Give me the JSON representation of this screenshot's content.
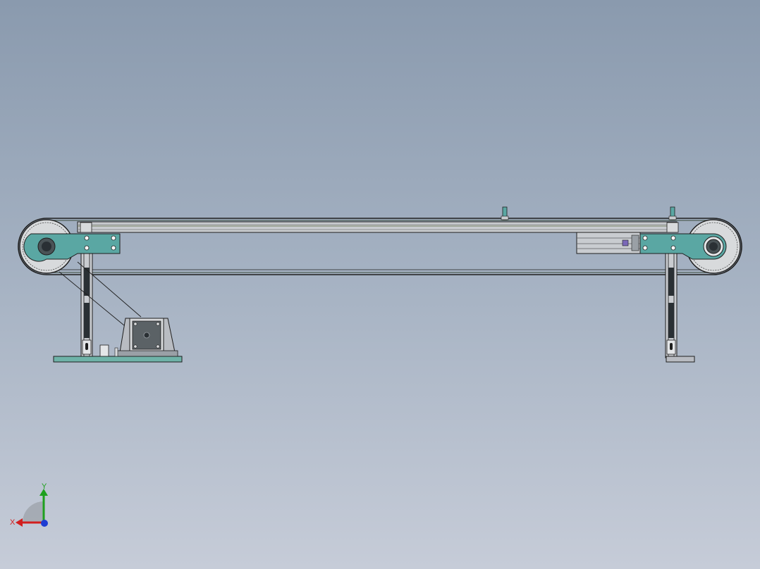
{
  "viewport": {
    "background_top": "#8a9aae",
    "background_bottom": "#c6ccd8"
  },
  "model": {
    "name": "belt conveyor",
    "colors": {
      "bracket": "#5aa7a3",
      "plate": "#6fb3a8",
      "belt": "#3a4a3c",
      "frame": "#c9ccd0",
      "outline": "#1e1e1e",
      "motor_body": "#b9bcc2",
      "pulley": "#d8dadc",
      "accent": "#7a68b8"
    }
  },
  "triad": {
    "x_label": "X",
    "y_label": "Y",
    "x_color": "#d21e1e",
    "y_color": "#1ea01e",
    "z_color": "#1e3cd2"
  }
}
